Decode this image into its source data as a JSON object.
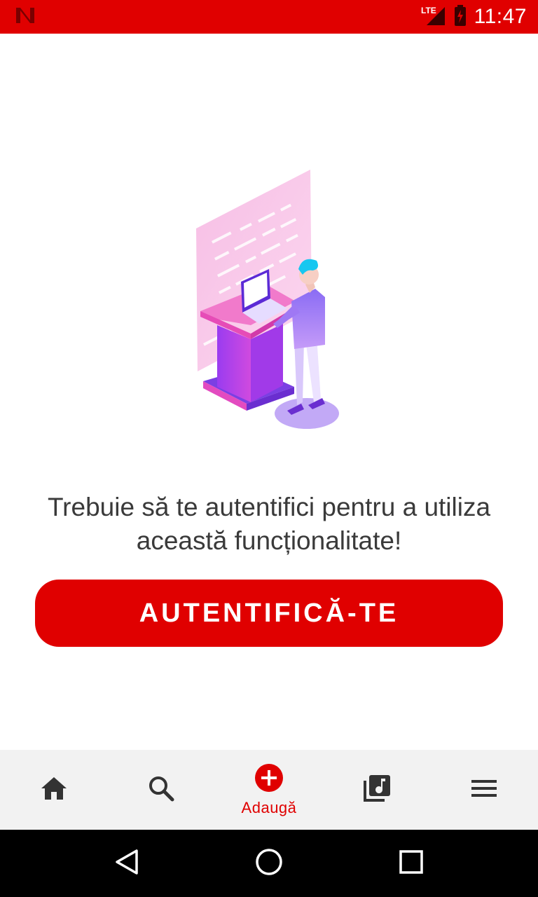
{
  "status_bar": {
    "time": "11:47",
    "network": "LTE",
    "app_icon": "netflix-n-icon",
    "color": "#e00000"
  },
  "main": {
    "message": "Trebuie să te autentifici pentru a utiliza această funcționalitate!",
    "login_button_label": "AUTENTIFICĂ-TE",
    "accent": "#e00000"
  },
  "bottom_nav": {
    "items": [
      {
        "icon": "home-icon",
        "label": ""
      },
      {
        "icon": "search-icon",
        "label": ""
      },
      {
        "icon": "add-circle-icon",
        "label": "Adaugă",
        "active": true
      },
      {
        "icon": "library-music-icon",
        "label": ""
      },
      {
        "icon": "menu-icon",
        "label": ""
      }
    ]
  },
  "system_nav": {
    "buttons": [
      "back-icon",
      "home-circle-icon",
      "recents-icon"
    ]
  }
}
